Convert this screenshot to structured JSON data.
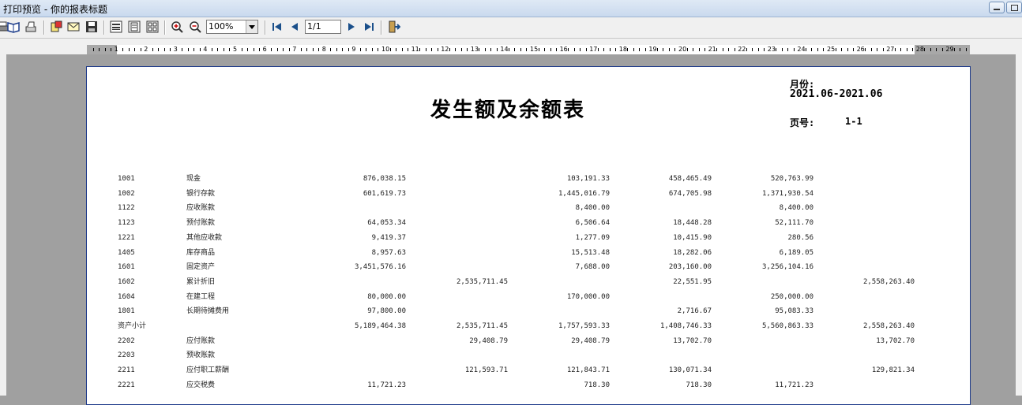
{
  "window": {
    "title": "打印预览 - 你的报表标题"
  },
  "toolbar": {
    "zoom": "100%",
    "page": "1/1"
  },
  "ruler": {
    "numbers": [
      "1",
      "2",
      "3",
      "4",
      "5",
      "6",
      "7",
      "8",
      "9",
      "10",
      "11",
      "12",
      "13",
      "14",
      "15",
      "16",
      "17",
      "18",
      "19",
      "20",
      "21",
      "22",
      "23",
      "24",
      "25",
      "26",
      "27",
      "28",
      "29"
    ]
  },
  "report": {
    "title": "发生额及余额表",
    "month_label": "月份:",
    "month_value": "2021.06-2021.06",
    "page_label": "页号:",
    "page_value": "1-1",
    "rows": [
      {
        "code": "1001",
        "name": "现金",
        "c1": "876,038.15",
        "c2": "",
        "c3": "103,191.33",
        "c4": "458,465.49",
        "c5": "520,763.99",
        "c6": ""
      },
      {
        "code": "1002",
        "name": "银行存款",
        "c1": "601,619.73",
        "c2": "",
        "c3": "1,445,016.79",
        "c4": "674,705.98",
        "c5": "1,371,930.54",
        "c6": ""
      },
      {
        "code": "1122",
        "name": "应收账款",
        "c1": "",
        "c2": "",
        "c3": "8,400.00",
        "c4": "",
        "c5": "8,400.00",
        "c6": ""
      },
      {
        "code": "1123",
        "name": "预付账款",
        "c1": "64,053.34",
        "c2": "",
        "c3": "6,506.64",
        "c4": "18,448.28",
        "c5": "52,111.70",
        "c6": ""
      },
      {
        "code": "1221",
        "name": "其他应收款",
        "c1": "9,419.37",
        "c2": "",
        "c3": "1,277.09",
        "c4": "10,415.90",
        "c5": "280.56",
        "c6": ""
      },
      {
        "code": "1405",
        "name": "库存商品",
        "c1": "8,957.63",
        "c2": "",
        "c3": "15,513.48",
        "c4": "18,282.06",
        "c5": "6,189.05",
        "c6": ""
      },
      {
        "code": "1601",
        "name": "固定资产",
        "c1": "3,451,576.16",
        "c2": "",
        "c3": "7,688.00",
        "c4": "203,160.00",
        "c5": "3,256,104.16",
        "c6": ""
      },
      {
        "code": "1602",
        "name": "累计折旧",
        "c1": "",
        "c2": "2,535,711.45",
        "c3": "",
        "c4": "22,551.95",
        "c5": "",
        "c6": "2,558,263.40"
      },
      {
        "code": "1604",
        "name": "在建工程",
        "c1": "80,000.00",
        "c2": "",
        "c3": "170,000.00",
        "c4": "",
        "c5": "250,000.00",
        "c6": ""
      },
      {
        "code": "1801",
        "name": "长期待摊费用",
        "c1": "97,800.00",
        "c2": "",
        "c3": "",
        "c4": "2,716.67",
        "c5": "95,083.33",
        "c6": ""
      },
      {
        "code": "资产小计",
        "name": "",
        "c1": "5,189,464.38",
        "c2": "2,535,711.45",
        "c3": "1,757,593.33",
        "c4": "1,408,746.33",
        "c5": "5,560,863.33",
        "c6": "2,558,263.40"
      },
      {
        "code": "2202",
        "name": "应付账款",
        "c1": "",
        "c2": "29,408.79",
        "c3": "29,408.79",
        "c4": "13,702.70",
        "c5": "",
        "c6": "13,702.70"
      },
      {
        "code": "2203",
        "name": "预收账款",
        "c1": "",
        "c2": "",
        "c3": "",
        "c4": "",
        "c5": "",
        "c6": ""
      },
      {
        "code": "2211",
        "name": "应付职工薪酬",
        "c1": "",
        "c2": "121,593.71",
        "c3": "121,843.71",
        "c4": "130,071.34",
        "c5": "",
        "c6": "129,821.34"
      },
      {
        "code": "2221",
        "name": "应交税费",
        "c1": "11,721.23",
        "c2": "",
        "c3": "718.30",
        "c4": "718.30",
        "c5": "11,721.23",
        "c6": ""
      }
    ]
  }
}
